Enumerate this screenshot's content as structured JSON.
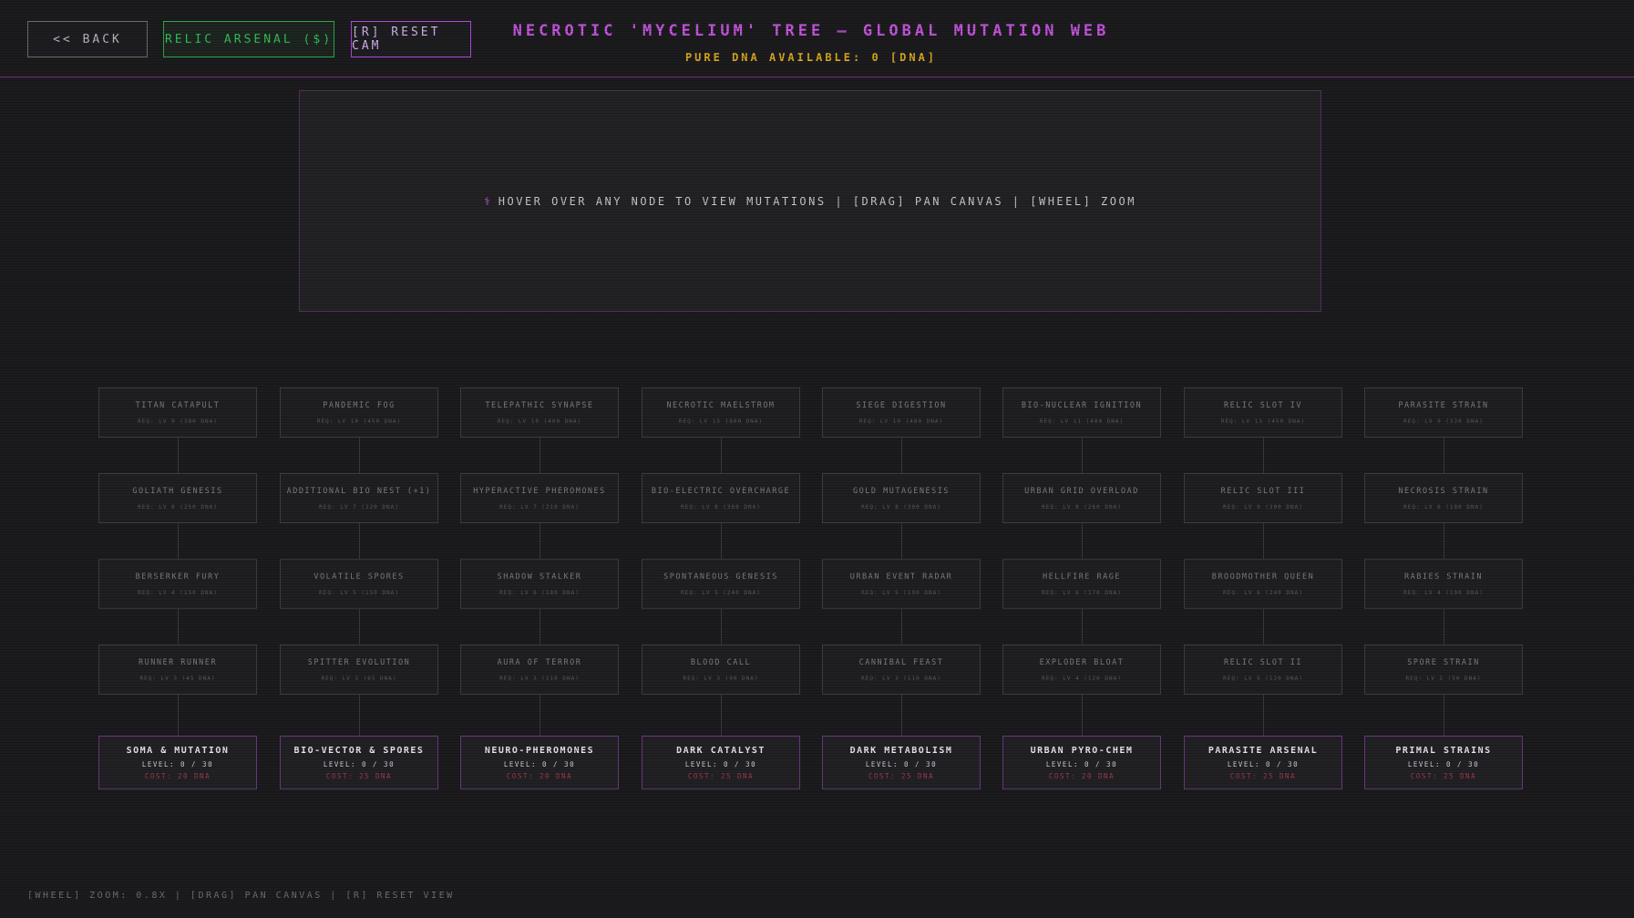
{
  "header": {
    "back_label": "<< BACK",
    "relic_label": "RELIC ARSENAL ($)",
    "reset_label": "[R] RESET CAM",
    "title": "NECROTIC 'MYCELIUM' TREE — GLOBAL MUTATION WEB",
    "dna_available": "PURE DNA AVAILABLE: 0 [DNA]"
  },
  "info_panel": {
    "icon": "dna-icon",
    "text": "HOVER OVER ANY NODE TO VIEW MUTATIONS | [DRAG] PAN CANVAS | [WHEEL] ZOOM"
  },
  "colors": {
    "accent_purple": "#c855e0",
    "dna_gold": "#d9a81c",
    "relic_green": "#36c05a",
    "cost_red": "#a33a4a"
  },
  "branches": [
    {
      "root": {
        "name": "SOMA & MUTATION",
        "level": "LEVEL: 0 / 30",
        "cost": "COST: 20 DNA"
      },
      "nodes": [
        {
          "name": "RUNNER RUNNER",
          "req": "REQ: LV 3 (45 DNA)"
        },
        {
          "name": "BERSERKER FURY",
          "req": "REQ: LV 4 (150 DNA)"
        },
        {
          "name": "GOLIATH GENESIS",
          "req": "REQ: LV 6 (250 DNA)"
        },
        {
          "name": "TITAN CATAPULT",
          "req": "REQ: LV 9 (380 DNA)"
        }
      ]
    },
    {
      "root": {
        "name": "BIO-VECTOR & SPORES",
        "level": "LEVEL: 0 / 30",
        "cost": "COST: 25 DNA"
      },
      "nodes": [
        {
          "name": "SPITTER EVOLUTION",
          "req": "REQ: LV 3 (65 DNA)"
        },
        {
          "name": "VOLATILE SPORES",
          "req": "REQ: LV 5 (150 DNA)"
        },
        {
          "name": "ADDITIONAL BIO NEST (+1)",
          "req": "REQ: LV 7 (220 DNA)"
        },
        {
          "name": "PANDEMIC FOG",
          "req": "REQ: LV 10 (450 DNA)"
        }
      ]
    },
    {
      "root": {
        "name": "NEURO-PHEROMONES",
        "level": "LEVEL: 0 / 30",
        "cost": "COST: 20 DNA"
      },
      "nodes": [
        {
          "name": "AURA OF TERROR",
          "req": "REQ: LV 3 (110 DNA)"
        },
        {
          "name": "SHADOW STALKER",
          "req": "REQ: LV 6 (180 DNA)"
        },
        {
          "name": "HYPERACTIVE PHEROMONES",
          "req": "REQ: LV 7 (210 DNA)"
        },
        {
          "name": "TELEPATHIC SYNAPSE",
          "req": "REQ: LV 10 (400 DNA)"
        }
      ]
    },
    {
      "root": {
        "name": "DARK CATALYST",
        "level": "LEVEL: 0 / 30",
        "cost": "COST: 25 DNA"
      },
      "nodes": [
        {
          "name": "BLOOD CALL",
          "req": "REQ: LV 3 (90 DNA)"
        },
        {
          "name": "SPONTANEOUS GENESIS",
          "req": "REQ: LV 5 (240 DNA)"
        },
        {
          "name": "BIO-ELECTRIC OVERCHARGE",
          "req": "REQ: LV 8 (360 DNA)"
        },
        {
          "name": "NECROTIC MAELSTROM",
          "req": "REQ: LV 15 (800 DNA)"
        }
      ]
    },
    {
      "root": {
        "name": "DARK METABOLISM",
        "level": "LEVEL: 0 / 30",
        "cost": "COST: 25 DNA"
      },
      "nodes": [
        {
          "name": "CANNIBAL FEAST",
          "req": "REQ: LV 3 (110 DNA)"
        },
        {
          "name": "URBAN EVENT RADAR",
          "req": "REQ: LV 5 (190 DNA)"
        },
        {
          "name": "GOLD MUTAGENESIS",
          "req": "REQ: LV 8 (300 DNA)"
        },
        {
          "name": "SIEGE DIGESTION",
          "req": "REQ: LV 10 (480 DNA)"
        }
      ]
    },
    {
      "root": {
        "name": "URBAN PYRO-CHEM",
        "level": "LEVEL: 0 / 30",
        "cost": "COST: 20 DNA"
      },
      "nodes": [
        {
          "name": "EXPLODER BLOAT",
          "req": "REQ: LV 4 (120 DNA)"
        },
        {
          "name": "HELLFIRE RAGE",
          "req": "REQ: LV 6 (170 DNA)"
        },
        {
          "name": "URBAN GRID OVERLOAD",
          "req": "REQ: LV 8 (260 DNA)"
        },
        {
          "name": "BIO-NUCLEAR IGNITION",
          "req": "REQ: LV 11 (480 DNA)"
        }
      ]
    },
    {
      "root": {
        "name": "PARASITE ARSENAL",
        "level": "LEVEL: 0 / 30",
        "cost": "COST: 25 DNA"
      },
      "nodes": [
        {
          "name": "RELIC SLOT II",
          "req": "REQ: LV 5 (120 DNA)"
        },
        {
          "name": "BROODMOTHER QUEEN",
          "req": "REQ: LV 6 (240 DNA)"
        },
        {
          "name": "RELIC SLOT III",
          "req": "REQ: LV 9 (300 DNA)"
        },
        {
          "name": "RELIC SLOT IV",
          "req": "REQ: LV 13 (450 DNA)"
        }
      ]
    },
    {
      "root": {
        "name": "PRIMAL STRAINS",
        "level": "LEVEL: 0 / 30",
        "cost": "COST: 25 DNA"
      },
      "nodes": [
        {
          "name": "SPORE STRAIN",
          "req": "REQ: LV 2 (50 DNA)"
        },
        {
          "name": "RABIES STRAIN",
          "req": "REQ: LV 4 (100 DNA)"
        },
        {
          "name": "NECROSIS STRAIN",
          "req": "REQ: LV 6 (180 DNA)"
        },
        {
          "name": "PARASITE STRAIN",
          "req": "REQ: LV 9 (320 DNA)"
        }
      ]
    }
  ],
  "footer": "[WHEEL] ZOOM: 0.8X  |  [DRAG] PAN CANVAS  |  [R] RESET VIEW"
}
